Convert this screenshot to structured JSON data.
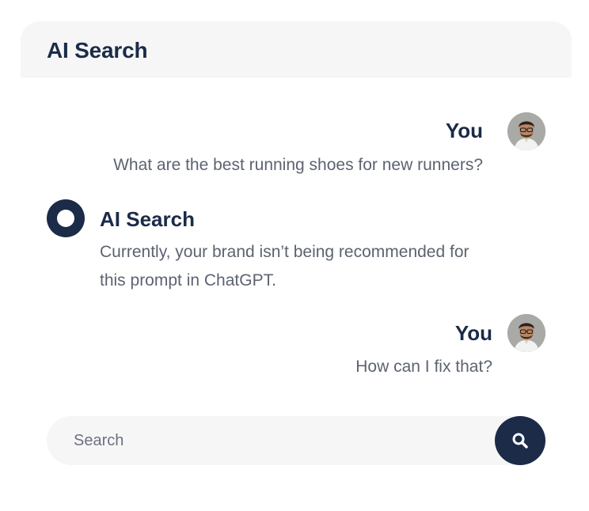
{
  "header": {
    "title": "AI Search"
  },
  "conversation": [
    {
      "sender": "You",
      "role": "user",
      "avatar_icon": "user-avatar-icon",
      "lines": [
        "What are the best running shoes for new runners?"
      ]
    },
    {
      "sender": "AI Search",
      "role": "assistant",
      "avatar_icon": "ai-search-logo-icon",
      "lines": [
        "Currently, your brand isn’t being recommended for",
        "this prompt in ChatGPT."
      ]
    },
    {
      "sender": "You",
      "role": "user",
      "avatar_icon": "user-avatar-icon",
      "lines": [
        "How can I fix that?"
      ]
    }
  ],
  "search": {
    "placeholder": "Search",
    "value": "",
    "button_icon": "search-icon"
  },
  "colors": {
    "primary": "#1b2b48",
    "header_bg": "#f6f6f6",
    "message_text": "#5c6370",
    "search_bg": "#f6f6f6"
  }
}
